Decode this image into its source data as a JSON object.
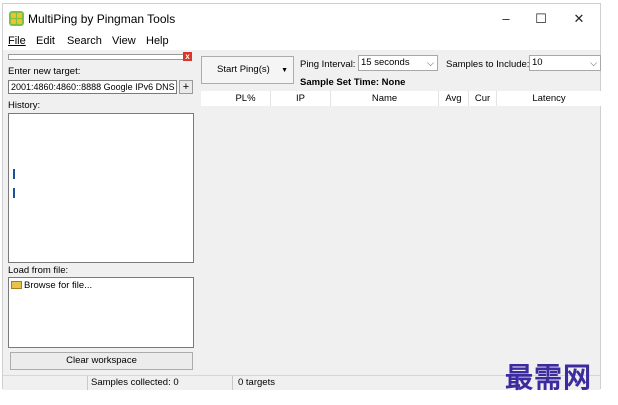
{
  "window": {
    "title": "MultiPing by Pingman Tools",
    "controls": {
      "minimize": "–",
      "maximize": "☐",
      "close": "✕"
    }
  },
  "menu": [
    "File",
    "Edit",
    "Search",
    "View",
    "Help"
  ],
  "left_panel": {
    "close_glyph": "x",
    "target_label": "Enter new target:",
    "target_value": "2001:4860:4860::8888 Google IPv6 DNS",
    "add_button": "+",
    "history_label": "History:",
    "load_label": "Load from file:",
    "browse_item": "Browse for file...",
    "clear_button": "Clear workspace"
  },
  "toolbar": {
    "start_button": "Start Ping(s)",
    "ping_interval_label": "Ping Interval:",
    "ping_interval_value": "15 seconds",
    "samples_label": "Samples to Include:",
    "samples_value": "10",
    "sample_set_time": "Sample Set Time: None"
  },
  "grid": {
    "columns": [
      "PL%",
      "IP",
      "Name",
      "Avg",
      "Cur",
      "Latency"
    ]
  },
  "status": {
    "samples_collected": "Samples collected: 0",
    "targets": "0 targets"
  },
  "watermark": "最需网"
}
